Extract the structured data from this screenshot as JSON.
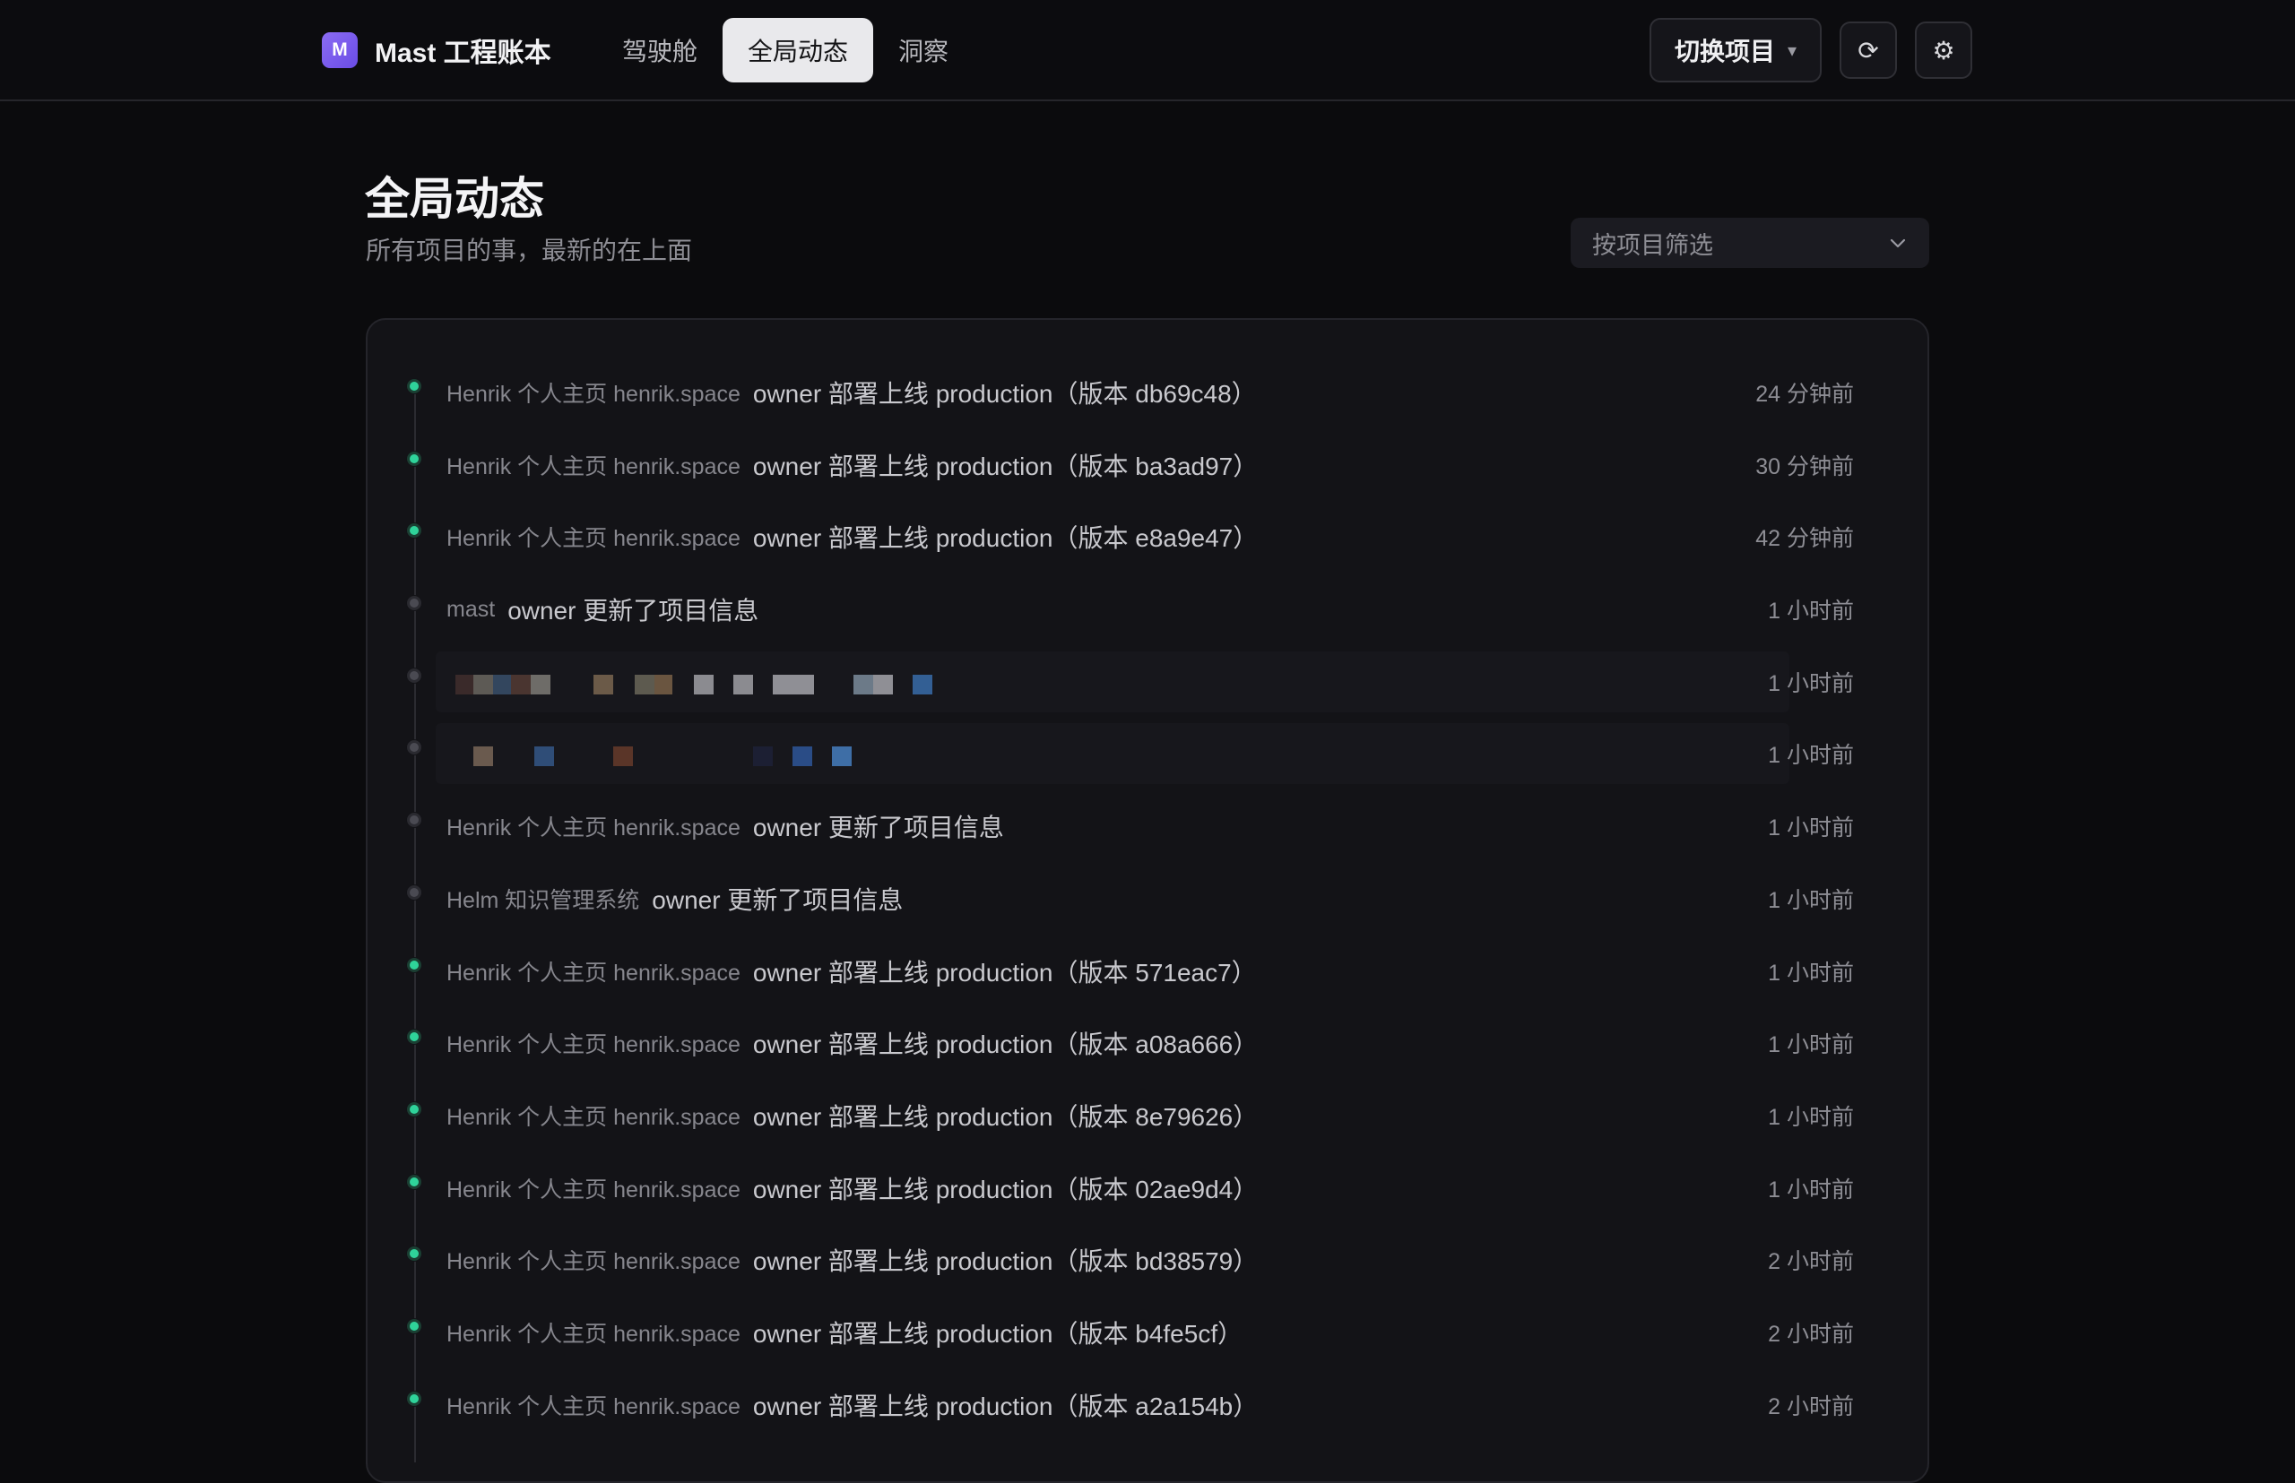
{
  "brand": {
    "logo_letter": "M",
    "name": "Mast 工程账本"
  },
  "nav": {
    "tabs": [
      {
        "label": "驾驶舱",
        "active": false
      },
      {
        "label": "全局动态",
        "active": true
      },
      {
        "label": "洞察",
        "active": false
      }
    ],
    "switch_project": "切换项目",
    "switch_caret": "▾",
    "refresh_icon": "⟳",
    "settings_icon": "⚙"
  },
  "page": {
    "title": "全局动态",
    "subtitle": "所有项目的事，最新的在上面",
    "filter_placeholder": "按项目筛选"
  },
  "feed": [
    {
      "kind": "deploy",
      "project": "Henrik 个人主页 henrik.space",
      "message": "owner 部署上线 production（版本 db69c48）",
      "time": "24 分钟前"
    },
    {
      "kind": "deploy",
      "project": "Henrik 个人主页 henrik.space",
      "message": "owner 部署上线 production（版本 ba3ad97）",
      "time": "30 分钟前"
    },
    {
      "kind": "deploy",
      "project": "Henrik 个人主页 henrik.space",
      "message": "owner 部署上线 production（版本 e8a9e47）",
      "time": "42 分钟前"
    },
    {
      "kind": "update",
      "project": "mast",
      "message": "owner 更新了项目信息",
      "time": "1 小时前"
    },
    {
      "kind": "redacted",
      "time": "1 小时前"
    },
    {
      "kind": "redacted",
      "time": "1 小时前"
    },
    {
      "kind": "update",
      "project": "Henrik 个人主页 henrik.space",
      "message": "owner 更新了项目信息",
      "time": "1 小时前"
    },
    {
      "kind": "update",
      "project": "Helm 知识管理系统",
      "message": "owner 更新了项目信息",
      "time": "1 小时前"
    },
    {
      "kind": "deploy",
      "project": "Henrik 个人主页 henrik.space",
      "message": "owner 部署上线 production（版本 571eac7）",
      "time": "1 小时前"
    },
    {
      "kind": "deploy",
      "project": "Henrik 个人主页 henrik.space",
      "message": "owner 部署上线 production（版本 a08a666）",
      "time": "1 小时前"
    },
    {
      "kind": "deploy",
      "project": "Henrik 个人主页 henrik.space",
      "message": "owner 部署上线 production（版本 8e79626）",
      "time": "1 小时前"
    },
    {
      "kind": "deploy",
      "project": "Henrik 个人主页 henrik.space",
      "message": "owner 部署上线 production（版本 02ae9d4）",
      "time": "1 小时前"
    },
    {
      "kind": "deploy",
      "project": "Henrik 个人主页 henrik.space",
      "message": "owner 部署上线 production（版本 bd38579）",
      "time": "2 小时前"
    },
    {
      "kind": "deploy",
      "project": "Henrik 个人主页 henrik.space",
      "message": "owner 部署上线 production（版本 b4fe5cf）",
      "time": "2 小时前"
    },
    {
      "kind": "deploy",
      "project": "Henrik 个人主页 henrik.space",
      "message": "owner 部署上线 production（版本 a2a154b）",
      "time": "2 小时前"
    }
  ]
}
